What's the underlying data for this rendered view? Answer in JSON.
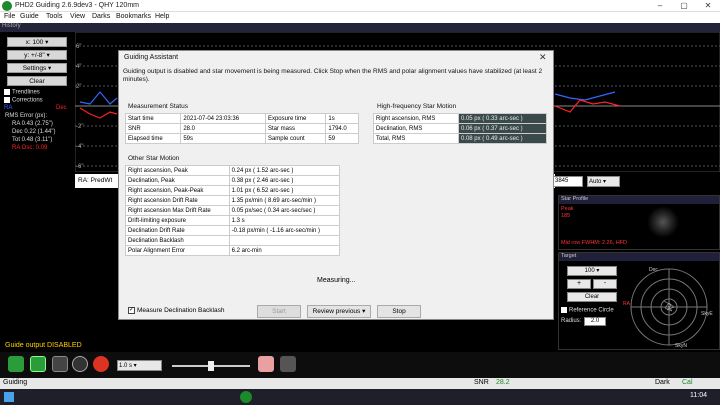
{
  "window": {
    "title": "PHD2 Guiding 2.6.9dev3 - QHY 120mm"
  },
  "menu": [
    "File",
    "Guide",
    "Tools",
    "View",
    "Darks",
    "Bookmarks",
    "Help"
  ],
  "history": {
    "header": "History",
    "x_select": "x: 100",
    "y_select": "y: +/-8\"",
    "settings": "Settings",
    "clear": "Clear",
    "trendlines": "Trendlines",
    "corrections": "Corrections",
    "ra_label": "RA",
    "dec_label": "Dec",
    "rms_title": "RMS Error (px):",
    "rms_ra": "RA 0.43 (2.75\")",
    "rms_dec": "Dec 0.22 (1.44\")",
    "rms_tot": "Tot 0.48 (3.11\")",
    "ra_osc": "RA Osc: 0.09",
    "y_ticks": [
      "6\"",
      "4\"",
      "2\"",
      "-2\"",
      "-4\"",
      "-6\""
    ],
    "ra_pred": "RA: PredWt"
  },
  "dialog": {
    "title": "Guiding Assistant",
    "close": "✕",
    "message": "Guiding output is disabled and star movement is being measured.  Click Stop when the RMS and polar alignment values have stabilized (at least 2 minutes).",
    "measurement_status": {
      "heading": "Measurement Status",
      "rows": [
        [
          "Start time",
          "2021-07-04 23:03:36",
          "Exposure time",
          "1s"
        ],
        [
          "SNR",
          "28.0",
          "Star mass",
          "1794.0"
        ],
        [
          "Elapsed time",
          "59s",
          "Sample count",
          "59"
        ]
      ]
    },
    "hf_motion": {
      "heading": "High-frequency Star Motion",
      "rows": [
        [
          "Right ascension, RMS",
          "0.05 px ( 0.33 arc-sec )"
        ],
        [
          "Declination, RMS",
          "0.06 px ( 0.37 arc-sec )"
        ],
        [
          "Total, RMS",
          "0.08 px ( 0.49 arc-sec )"
        ]
      ]
    },
    "other_motion": {
      "heading": "Other Star Motion",
      "rows": [
        [
          "Right ascension, Peak",
          "0.24 px ( 1.52 arc-sec )"
        ],
        [
          "Declination, Peak",
          "0.38 px ( 2.46 arc-sec )"
        ],
        [
          "Right ascension, Peak-Peak",
          "1.01 px ( 6.52 arc-sec )"
        ],
        [
          "Right ascension Drift Rate",
          "1.35 px/min ( 8.69 arc-sec/min )"
        ],
        [
          "Right ascension Max Drift Rate",
          "0.05 px/sec ( 0.34 arc-sec/sec )"
        ],
        [
          "Drift-limiting exposure",
          "1.3 s"
        ],
        [
          "Declination Drift Rate",
          "-0.18 px/min ( -1.16 arc-sec/min )"
        ],
        [
          "Declination Backlash",
          ""
        ],
        [
          "Polar Alignment Error",
          "6.2 arc-min"
        ]
      ]
    },
    "measuring": "Measuring...",
    "measure_backlash": "Measure Declination Backlash",
    "start": "Start",
    "review": "Review previous",
    "stop": "Stop"
  },
  "guide_status": "Guide output DISABLED",
  "toolbar": {
    "exposure": "1.0 s",
    "gain_value": "3845",
    "auto": "Auto"
  },
  "star_profile": {
    "header": "Star Profile",
    "peak_label": "Peak",
    "peak_value": "185",
    "mid": "Mid row FWHM: 2.26, HFD"
  },
  "target": {
    "header": "Target",
    "zoom": "100",
    "minus": "-",
    "plus": "+",
    "clear": "Clear",
    "reference_circle": "Reference Circle",
    "radius_label": "Radius:",
    "radius": "2.0",
    "labels": {
      "dec": "Dec",
      "ra": "RA",
      "skye": "SkyE",
      "skyn": "SkyN"
    }
  },
  "statusbar": {
    "mode": "Guiding",
    "snr_label": "SNR",
    "snr": "28.2",
    "dark": "Dark",
    "cal": "Cal"
  },
  "taskbar": {
    "time": "11:04"
  },
  "colors": {
    "ra": "#3366ff",
    "dec": "#ff2222",
    "accent": "#ffd000"
  }
}
